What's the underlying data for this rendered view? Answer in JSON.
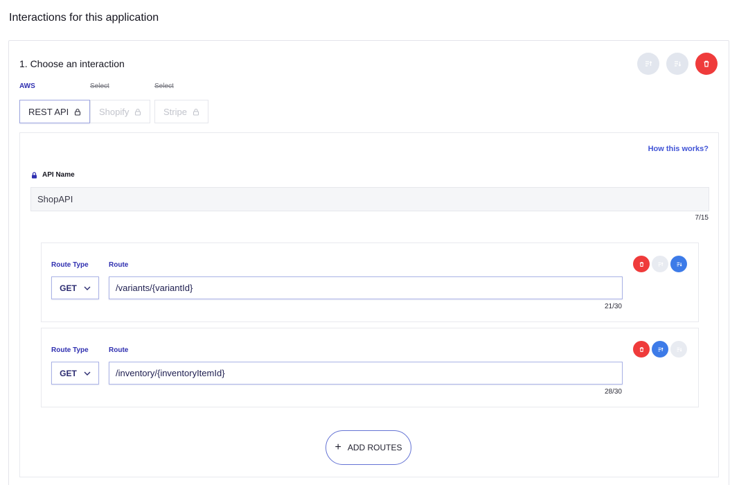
{
  "page": {
    "title": "Interactions for this application"
  },
  "interaction": {
    "title": "1. Choose an interaction",
    "providers": [
      {
        "label": "AWS",
        "option": "REST API",
        "state": "active"
      },
      {
        "label": "Select",
        "option": "Shopify",
        "state": "disabled"
      },
      {
        "label": "Select",
        "option": "Stripe",
        "state": "disabled"
      }
    ],
    "help_link": "How this works?",
    "api_name": {
      "label": "API Name",
      "value": "ShopAPI",
      "counter": "7/15"
    },
    "routes": [
      {
        "type_label": "Route Type",
        "route_label": "Route",
        "method": "GET",
        "path": "/variants/{variantId}",
        "counter": "21/30"
      },
      {
        "type_label": "Route Type",
        "route_label": "Route",
        "method": "GET",
        "path": "/inventory/{inventoryItemId}",
        "counter": "28/30"
      }
    ],
    "add_routes_label": "ADD ROUTES"
  },
  "colors": {
    "accent": "#2f2fb0",
    "danger": "#ef3b3b",
    "primary": "#3d7be8",
    "link": "#4154d6"
  }
}
